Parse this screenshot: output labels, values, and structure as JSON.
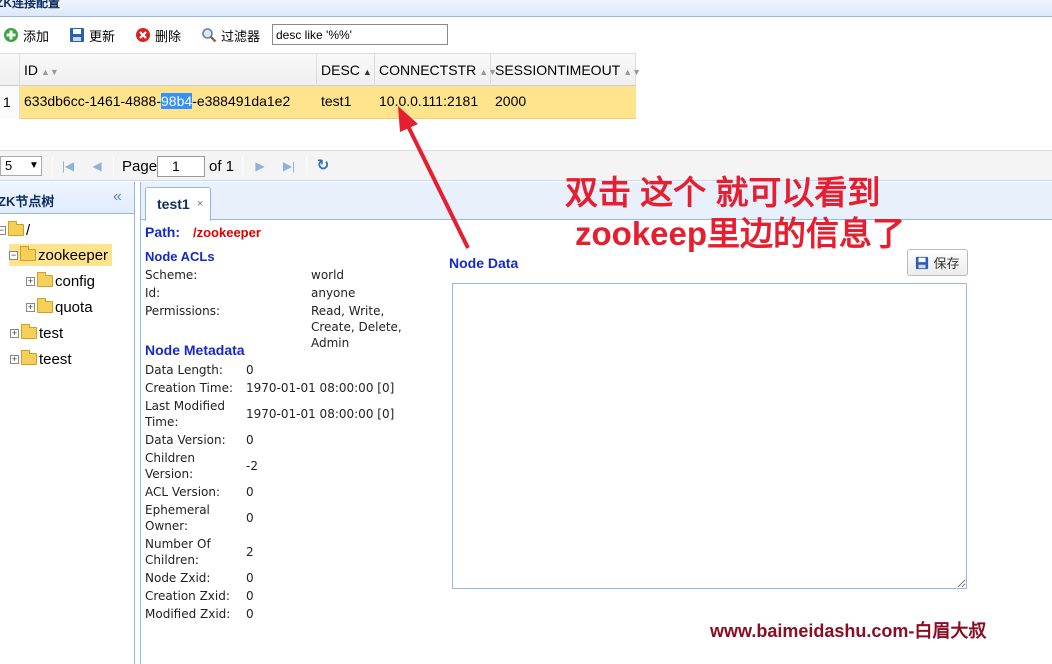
{
  "window": {
    "title": "ZK连接配置"
  },
  "toolbar": {
    "add_label": "添加",
    "update_label": "更新",
    "delete_label": "删除",
    "filter_label": "过滤器",
    "filter_value": "desc like '%%'"
  },
  "grid": {
    "columns": [
      "ID",
      "DESC",
      "CONNECTSTR",
      "SESSIONTIMEOUT"
    ],
    "sorted_column": "DESC",
    "rows": [
      {
        "num": "1",
        "id_part1": "633db6cc-1461-4888-",
        "id_selected": "98b4",
        "id_part2": "-e388491da1e2",
        "desc": "test1",
        "connectstr": "10.0.0.111:2181",
        "sessiontimeout": "2000"
      }
    ]
  },
  "pager": {
    "page_size": "5",
    "page_label": "Page",
    "page_number": "1",
    "of_label": "of 1"
  },
  "tree": {
    "title": "ZK节点树",
    "nodes": [
      "/",
      "zookeeper",
      "config",
      "quota",
      "test",
      "teest"
    ],
    "selected": "zookeeper"
  },
  "tab": {
    "label": "test1",
    "close": "×"
  },
  "node": {
    "path_label": "Path:",
    "path_value": "/zookeeper",
    "acls_title": "Node ACLs",
    "acls": [
      {
        "key": "Scheme:",
        "value": "world"
      },
      {
        "key": "Id:",
        "value": "anyone"
      },
      {
        "key": "Permissions:",
        "value": "Read, Write, Create, Delete, Admin"
      }
    ],
    "metadata_title": "Node Metadata",
    "metadata": [
      {
        "key": "Data Length:",
        "value": "0"
      },
      {
        "key": "Creation Time:",
        "value": "1970-01-01 08:00:00 [0]"
      },
      {
        "key": "Last Modified Time:",
        "value": "1970-01-01 08:00:00 [0]"
      },
      {
        "key": "Data Version:",
        "value": "0"
      },
      {
        "key": "Children Version:",
        "value": "-2"
      },
      {
        "key": "ACL Version:",
        "value": "0"
      },
      {
        "key": "Ephemeral Owner:",
        "value": "0"
      },
      {
        "key": "Number Of Children:",
        "value": "2"
      },
      {
        "key": "Node Zxid:",
        "value": "0"
      },
      {
        "key": "Creation Zxid:",
        "value": "0"
      },
      {
        "key": "Modified Zxid:",
        "value": "0"
      }
    ],
    "data_title": "Node Data",
    "data_value": "",
    "save_label": "保存"
  },
  "annotation": {
    "line1": "双击 这个 就可以看到",
    "line2": "zookeep里边的信息了"
  },
  "watermark": "www.baimeidashu.com-白眉大叔",
  "colors": {
    "accent": "#95b8e7",
    "selection": "#ffe48d",
    "annotation": "#e51f2f"
  },
  "icons": [
    "add-icon",
    "save-icon",
    "delete-icon",
    "search-icon",
    "first-page-icon",
    "prev-page-icon",
    "next-page-icon",
    "last-page-icon",
    "refresh-icon",
    "collapse-icon",
    "folder-icon"
  ]
}
